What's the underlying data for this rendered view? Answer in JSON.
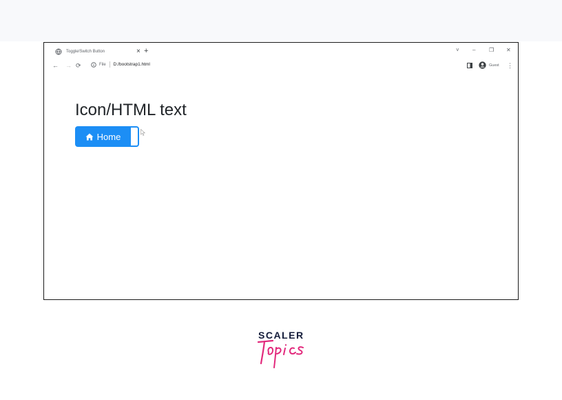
{
  "browser": {
    "tab": {
      "title": "Toggle/Switch Button",
      "close_icon": "close-icon"
    },
    "new_tab_icon": "plus-icon",
    "window_controls": {
      "dropdown": "˅",
      "minimize": "–",
      "restore": "❐",
      "close": "✕"
    },
    "nav": {
      "back": "←",
      "forward": "→",
      "reload": "⟳"
    },
    "address": {
      "scheme_label": "File",
      "url": "D:/bootstrap1.html"
    },
    "profile": {
      "label": "Guest"
    },
    "menu": "⋮"
  },
  "page": {
    "heading": "Icon/HTML text",
    "button": {
      "label": "Home",
      "icon": "home-icon",
      "color": "#1c8ef5"
    }
  },
  "logo": {
    "line1": "SCALER",
    "line2": "Topics"
  },
  "colors": {
    "accent": "#1c8ef5",
    "brand_dark": "#141c3a",
    "brand_pink": "#e2297c"
  }
}
